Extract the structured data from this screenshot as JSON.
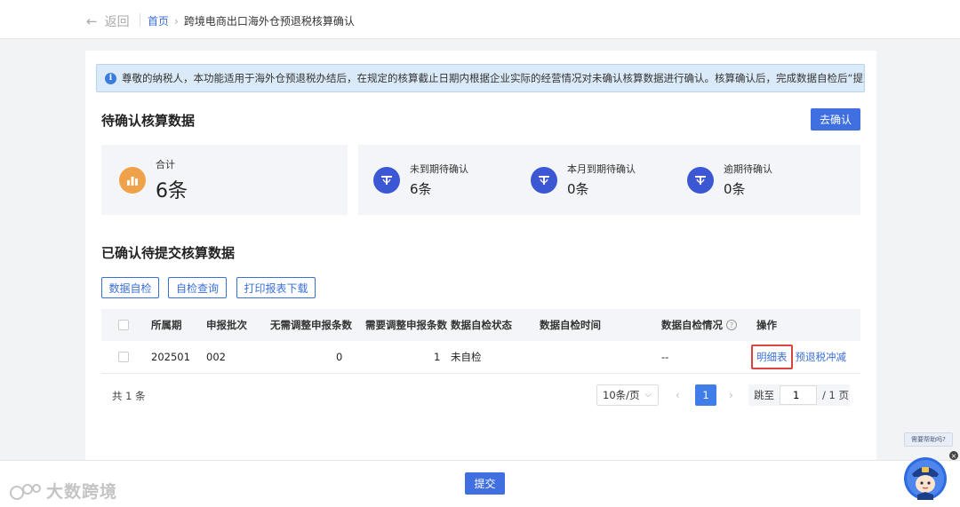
{
  "header": {
    "back_label": "返回",
    "breadcrumb": {
      "home": "首页",
      "separator": "›",
      "current": "跨境电商出口海外仓预退税核算确认"
    }
  },
  "notice": {
    "icon": "info-icon",
    "text": "尊敬的纳税人，本功能适用于海外仓预退税办结后，在规定的核算截止日期内根据企业实际的经营情况对未确认核算数据进行确认。核算确认后，完成数据自检后“提交”即可。"
  },
  "pending": {
    "title": "待确认核算数据",
    "confirm_button": "去确认",
    "total": {
      "label": "合计",
      "value": "6条",
      "icon": "bar-chart-icon",
      "color": "#f0a24a"
    },
    "stats": [
      {
        "label": "未到期待确认",
        "value": "6条",
        "icon": "tax-refund-icon",
        "color": "#3c57d4"
      },
      {
        "label": "本月到期待确认",
        "value": "0条",
        "icon": "tax-refund-icon",
        "color": "#3c57d4"
      },
      {
        "label": "逾期待确认",
        "value": "0条",
        "icon": "tax-refund-icon",
        "color": "#3c57d4"
      }
    ]
  },
  "confirmed": {
    "title": "已确认待提交核算数据",
    "buttons": {
      "self_check": "数据自检",
      "check_query": "自检查询",
      "print_download": "打印报表下载"
    },
    "table": {
      "columns": [
        "所属期",
        "申报批次",
        "无需调整申报条数",
        "需要调整申报条数",
        "数据自检状态",
        "数据自检时间",
        "数据自检情况",
        "操作"
      ],
      "rows": [
        {
          "period": "202501",
          "batch": "002",
          "no_adjust": "0",
          "need_adjust": "1",
          "status": "未自检",
          "time": "",
          "situation": "--",
          "action_detail": "明细表",
          "action_offset": "预退税冲减"
        }
      ]
    },
    "pagination": {
      "total": "共 1 条",
      "page_size": "10条/页",
      "current_page": "1",
      "jump_label": "跳至",
      "jump_value": "1",
      "page_total": "/ 1 页"
    }
  },
  "footer": {
    "submit_button": "提交",
    "watermark": "大数跨境"
  },
  "assistant": {
    "tip": "需要帮助吗?",
    "close": "×",
    "badge": "征纳互动"
  },
  "colors": {
    "primary": "#3f6fe0",
    "link": "#3a6fd8",
    "highlight_border": "#d9443c",
    "notice_bg": "#dbeaf8"
  }
}
